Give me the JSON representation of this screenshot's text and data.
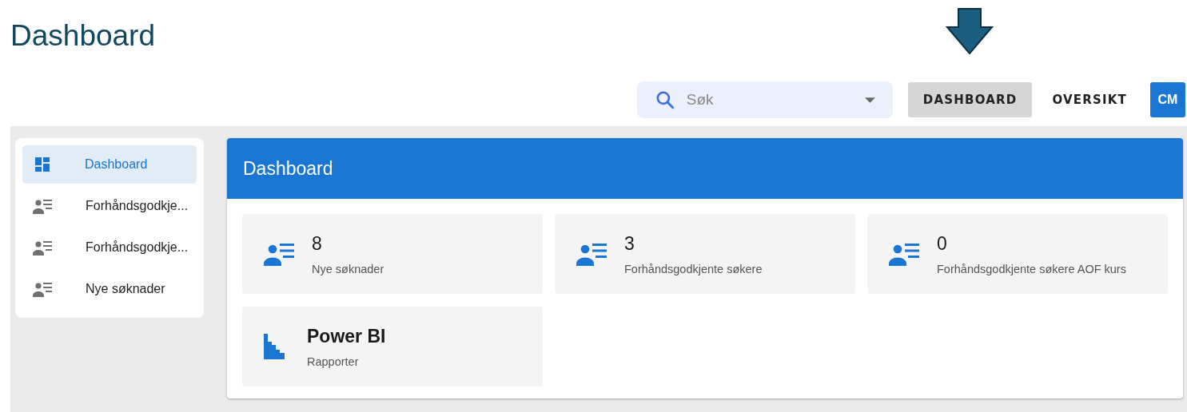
{
  "page_title": "Dashboard",
  "search": {
    "placeholder": "Søk"
  },
  "nav": [
    {
      "label": "DASHBOARD",
      "selected": true
    },
    {
      "label": "OVERSIKT",
      "selected": false
    }
  ],
  "avatar": "CM",
  "sidebar": {
    "items": [
      {
        "label": "Dashboard",
        "kind": "dashboard",
        "selected": true
      },
      {
        "label": "Forhåndsgodkje...",
        "kind": "person-list",
        "selected": false
      },
      {
        "label": "Forhåndsgodkje...",
        "kind": "person-list",
        "selected": false
      },
      {
        "label": "Nye søknader",
        "kind": "person-list",
        "selected": false
      }
    ]
  },
  "panel": {
    "title": "Dashboard",
    "tiles": [
      {
        "kind": "person-list",
        "value": "8",
        "label": "Nye søknader"
      },
      {
        "kind": "person-list",
        "value": "3",
        "label": "Forhåndsgodkjente søkere"
      },
      {
        "kind": "person-list",
        "value": "0",
        "label": "Forhåndsgodkjente søkere AOF kurs"
      },
      {
        "kind": "chart",
        "value": "Power BI",
        "label": "Rapporter"
      }
    ]
  }
}
